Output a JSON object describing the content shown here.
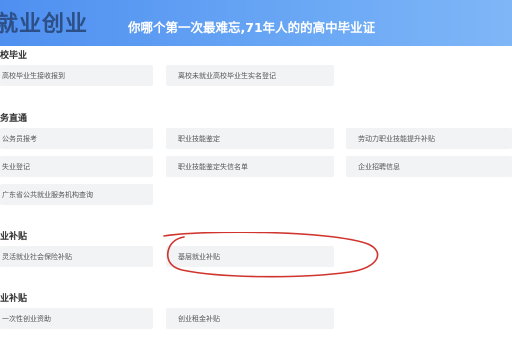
{
  "header": {
    "logo_text": "就业创业",
    "banner_text": "你哪个第一次最难忘,71年人的的高中毕业证"
  },
  "sections": [
    {
      "title": "校毕业",
      "items": [
        [
          "高校毕业生接收报到",
          "离校未就业高校毕业生实名登记"
        ]
      ]
    },
    {
      "title": "务直通",
      "items": [
        [
          "公务员报考",
          "职业技能鉴定",
          "劳动力职业技能提升补贴"
        ],
        [
          "失业登记",
          "职业技能鉴定失信名单",
          "企业招聘信息"
        ],
        [
          "广东省公共就业服务机构查询"
        ]
      ]
    },
    {
      "title": "业补贴",
      "items": [
        [
          "灵活就业社会保险补贴",
          "基层就业补贴"
        ]
      ]
    },
    {
      "title": "业补贴",
      "items": [
        [
          "一次性创业资助",
          "创业租金补贴"
        ]
      ]
    }
  ],
  "highlight_color": "#d0342c",
  "accent_color": "#4f8ff0"
}
